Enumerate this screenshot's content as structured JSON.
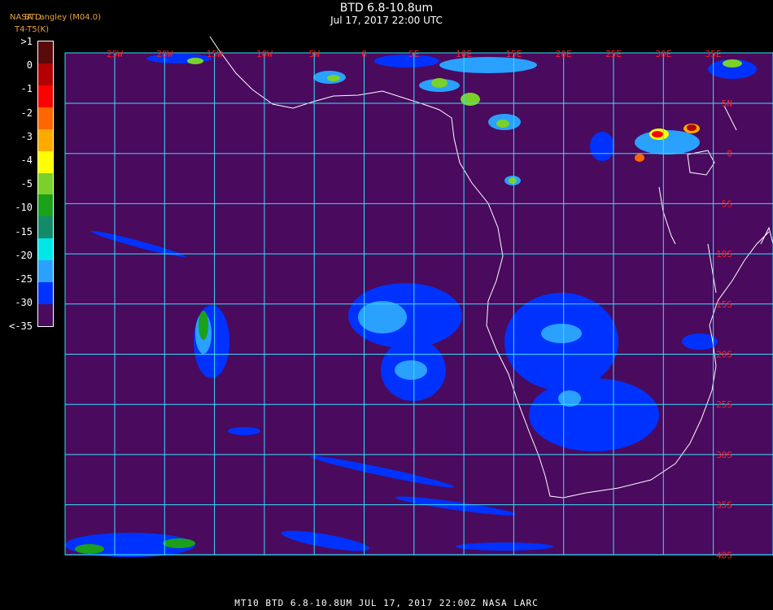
{
  "title": "BTD 6.8-10.8um",
  "subtitle": "Jul 17, 2017 22:00 UTC",
  "agency": "NASA Langley (M04.0)",
  "product_short": "BTD",
  "units": "T4-T5(K)",
  "footer": "MT10  BTD 6.8-10.8UM   JUL 17, 2017 22:00Z  NASA LARC",
  "colorbar": {
    "labels": [
      ">1",
      "0",
      "-1",
      "-2",
      "-3",
      "-4",
      "-5",
      "-10",
      "-15",
      "-20",
      "-25",
      "-30",
      "<-35"
    ],
    "colors": [
      "#5a0a0a",
      "#b30000",
      "#ff0000",
      "#ff6600",
      "#ffaa00",
      "#ffff00",
      "#7ad12a",
      "#1aa01a",
      "#138a6a",
      "#00e6e6",
      "#2aa0ff",
      "#0032ff",
      "#4a0a5e"
    ]
  },
  "map": {
    "lon_labels": [
      "25W",
      "20W",
      "15W",
      "10W",
      "5W",
      "0",
      "5E",
      "10E",
      "15E",
      "20E",
      "25E",
      "30E",
      "35E"
    ],
    "lat_labels": [
      "5N",
      "0",
      "5S",
      "10S",
      "15S",
      "20S",
      "25S",
      "30S",
      "35S",
      "40S"
    ],
    "background": "#4a0a5e",
    "grid_color": "#36e0ff",
    "label_color": "#ff2020"
  }
}
